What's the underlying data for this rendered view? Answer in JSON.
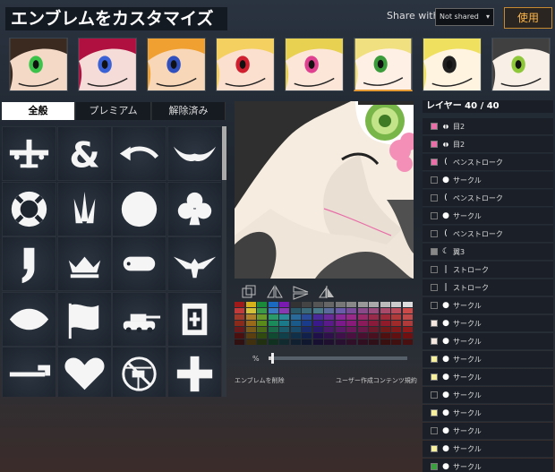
{
  "header": {
    "title": "エンブレムをカスタマイズ",
    "share_label": "Share with:",
    "share_value": "Not shared",
    "use_button": "使用"
  },
  "templates": [
    {
      "name": "template-1",
      "bg": "#f4d9c6",
      "hair": "#3a2a20",
      "accent": "#3ac24a"
    },
    {
      "name": "template-2",
      "bg": "#f6dcd8",
      "hair": "#b01040",
      "accent": "#3a62d6"
    },
    {
      "name": "template-3",
      "bg": "#f8d7b8",
      "hair": "#f0a030",
      "accent": "#3050c0"
    },
    {
      "name": "template-4",
      "bg": "#fbe0d0",
      "hair": "#f4d060",
      "accent": "#d02030"
    },
    {
      "name": "template-5",
      "bg": "#fbe6d8",
      "hair": "#e8d050",
      "accent": "#e04090"
    },
    {
      "name": "template-6",
      "bg": "#fff0e6",
      "hair": "#f0e080",
      "accent": "#3a9c3a"
    },
    {
      "name": "template-7",
      "bg": "#fff4e0",
      "hair": "#f0e060",
      "accent": "#202020"
    },
    {
      "name": "template-8",
      "bg": "#f8efe6",
      "hair": "#404040",
      "accent": "#8ec83a"
    }
  ],
  "tabs": [
    {
      "label": "全般",
      "active": true
    },
    {
      "label": "プレミアム",
      "active": false
    },
    {
      "label": "解除済み",
      "active": false
    }
  ],
  "icons": [
    "airplane-icon",
    "ampersand-icon",
    "curved-arrow-icon",
    "wings-icon",
    "lifebuoy-icon",
    "flame-blades-icon",
    "circle-icon",
    "club-icon",
    "comma-icon",
    "crown-icon",
    "dog-tag-icon",
    "eagle-icon",
    "leaf-icon",
    "flag-icon",
    "tank-icon",
    "medkit-icon",
    "hammer-icon",
    "heart-icon",
    "prohibited-helicopter-icon",
    "cross-icon"
  ],
  "palette": {
    "colors": [
      [
        "#a01a1a",
        "#d6b11a",
        "#1a8a3a",
        "#1a6ac2",
        "#7a1ab0",
        "#333333",
        "#444444",
        "#555555",
        "#666666",
        "#777777",
        "#888888",
        "#999999",
        "#aaaaaa",
        "#bbbbbb",
        "#cccccc",
        "#dddddd"
      ],
      [
        "#c23a3a",
        "#d6c23a",
        "#3a9a4a",
        "#3a7ac2",
        "#8a3ab0",
        "#2a5a6a",
        "#3a6a7a",
        "#4a7a8a",
        "#5a6a9a",
        "#6a5aaa",
        "#7a4a9a",
        "#8a4a8a",
        "#9a4a7a",
        "#aa4a6a",
        "#ba4a5a",
        "#ca4a4a"
      ],
      [
        "#a03a2a",
        "#b0802a",
        "#6a9a2a",
        "#2a9a6a",
        "#2a8a9a",
        "#2a6a9a",
        "#2a4a9a",
        "#4a2a9a",
        "#6a2a9a",
        "#8a2a9a",
        "#9a2a8a",
        "#9a2a6a",
        "#9a2a4a",
        "#a02a3a",
        "#b03a3a",
        "#c04a4a"
      ],
      [
        "#8a2a1a",
        "#9a6a1a",
        "#5a8a1a",
        "#1a8a5a",
        "#1a7a8a",
        "#1a5a8a",
        "#1a3a8a",
        "#3a1a8a",
        "#5a1a8a",
        "#7a1a8a",
        "#8a1a7a",
        "#8a1a5a",
        "#8a1a3a",
        "#901a2a",
        "#a02a2a",
        "#b03a3a"
      ],
      [
        "#6a1a1a",
        "#7a5a1a",
        "#4a6a1a",
        "#1a6a4a",
        "#1a5a6a",
        "#1a4a6a",
        "#1a2a6a",
        "#2a1a6a",
        "#4a1a6a",
        "#5a1a6a",
        "#6a1a5a",
        "#6a1a4a",
        "#6a1a2a",
        "#701a1a",
        "#801a1a",
        "#901a1a"
      ],
      [
        "#4a1010",
        "#5a4010",
        "#304a10",
        "#104a30",
        "#10404a",
        "#10304a",
        "#10204a",
        "#20104a",
        "#30104a",
        "#40104a",
        "#4a1040",
        "#4a1030",
        "#4a1020",
        "#501010",
        "#601010",
        "#701010"
      ],
      [
        "#301010",
        "#403010",
        "#203010",
        "#103020",
        "#102a30",
        "#102030",
        "#101830",
        "#181030",
        "#201030",
        "#281030",
        "#301028",
        "#301020",
        "#301018",
        "#381010",
        "#401010",
        "#481010"
      ]
    ]
  },
  "controls": {
    "size_label": "%",
    "size_value": 0.02,
    "delete_link": "エンブレムを削除",
    "terms_link": "ユーザー作成コンテンツ規約"
  },
  "layers": {
    "header": "レイヤー 40 / 40",
    "items": [
      {
        "name": "目2",
        "glyph": "eye",
        "color": "#e86fa8",
        "selected": true
      },
      {
        "name": "目2",
        "glyph": "eye",
        "color": "#e86fa8",
        "selected": true
      },
      {
        "name": "ペンストローク",
        "glyph": "paren",
        "color": "#e86fa8",
        "selected": true
      },
      {
        "name": "サークル",
        "glyph": "dot",
        "color": "",
        "selected": false
      },
      {
        "name": "ペンストローク",
        "glyph": "paren",
        "color": "",
        "selected": false
      },
      {
        "name": "サークル",
        "glyph": "dot",
        "color": "",
        "selected": false
      },
      {
        "name": "ペンストローク",
        "glyph": "paren",
        "color": "",
        "selected": false
      },
      {
        "name": "翼3",
        "glyph": "moon",
        "color": "#888888",
        "selected": false
      },
      {
        "name": "ストローク",
        "glyph": "bar",
        "color": "",
        "selected": false
      },
      {
        "name": "ストローク",
        "glyph": "bar",
        "color": "",
        "selected": false
      },
      {
        "name": "サークル",
        "glyph": "dot",
        "color": "",
        "selected": false
      },
      {
        "name": "サークル",
        "glyph": "dot",
        "color": "#f4e8e0",
        "selected": false
      },
      {
        "name": "サークル",
        "glyph": "dot",
        "color": "#f4e8e0",
        "selected": false
      },
      {
        "name": "サークル",
        "glyph": "dot",
        "color": "#f6f0a0",
        "selected": false
      },
      {
        "name": "サークル",
        "glyph": "dot",
        "color": "#f6f0a0",
        "selected": false
      },
      {
        "name": "サークル",
        "glyph": "dot",
        "color": "",
        "selected": false
      },
      {
        "name": "サークル",
        "glyph": "dot",
        "color": "#f6f0a0",
        "selected": false
      },
      {
        "name": "サークル",
        "glyph": "dot",
        "color": "",
        "selected": false
      },
      {
        "name": "サークル",
        "glyph": "dot",
        "color": "#f6f0a0",
        "selected": false
      },
      {
        "name": "サークル",
        "glyph": "dot",
        "color": "#3aa040",
        "selected": false
      }
    ]
  }
}
